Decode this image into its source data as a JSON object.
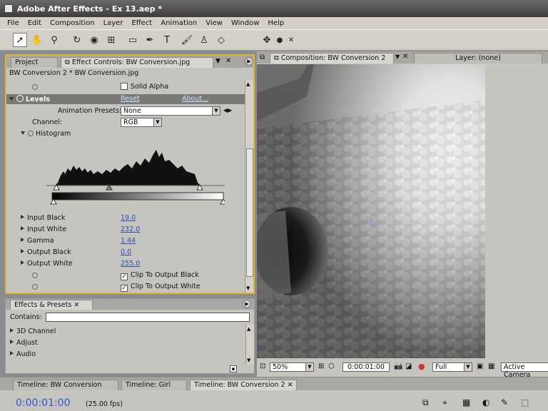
{
  "window": {
    "title": "Adobe After Effects - Ex 13.aep *"
  },
  "menu": [
    "File",
    "Edit",
    "Composition",
    "Layer",
    "Effect",
    "Animation",
    "View",
    "Window",
    "Help"
  ],
  "left_panel": {
    "tabs": [
      "Project",
      "Effect Controls: BW Conversion.jpg"
    ],
    "breadcrumb": "BW Conversion 2 * BW Conversion.jpg",
    "solid_alpha_label": "Solid Alpha",
    "effect_name": "Levels",
    "reset_label": "Reset",
    "about_label": "About...",
    "animation_presets_label": "Animation Presets:",
    "animation_presets_value": "None",
    "channel_label": "Channel:",
    "channel_value": "RGB",
    "histogram_label": "Histogram",
    "properties": [
      {
        "label": "Input Black",
        "value": "19.0"
      },
      {
        "label": "Input White",
        "value": "232.0"
      },
      {
        "label": "Gamma",
        "value": "1.44"
      },
      {
        "label": "Output Black",
        "value": "0.0"
      },
      {
        "label": "Output White",
        "value": "255.0"
      }
    ],
    "clip_black_label": "Clip To Output Black",
    "clip_white_label": "Clip To Output White",
    "clip_black_checked": true,
    "clip_white_checked": true
  },
  "effects_panel": {
    "tab": "Effects & Presets",
    "contains_label": "Contains:",
    "contains_value": "",
    "categories": [
      "3D Channel",
      "Adjust",
      "Audio"
    ]
  },
  "comp_panel": {
    "tabs": [
      "Composition: BW Conversion 2",
      "Layer: (none)"
    ],
    "zoom": "50%",
    "time": "0:00:01:00",
    "resolution": "Full",
    "camera": "Active Camera"
  },
  "timeline": {
    "tabs": [
      "Timeline: BW Conversion",
      "Timeline: Girl",
      "Timeline: BW Conversion 2"
    ],
    "current_time": "0:00:01:00",
    "fps": "(25.00 fps)"
  },
  "colors": {
    "panel_highlight": "#e2b33c",
    "link": "#2a4fb0",
    "timecode": "#2c58c8"
  }
}
